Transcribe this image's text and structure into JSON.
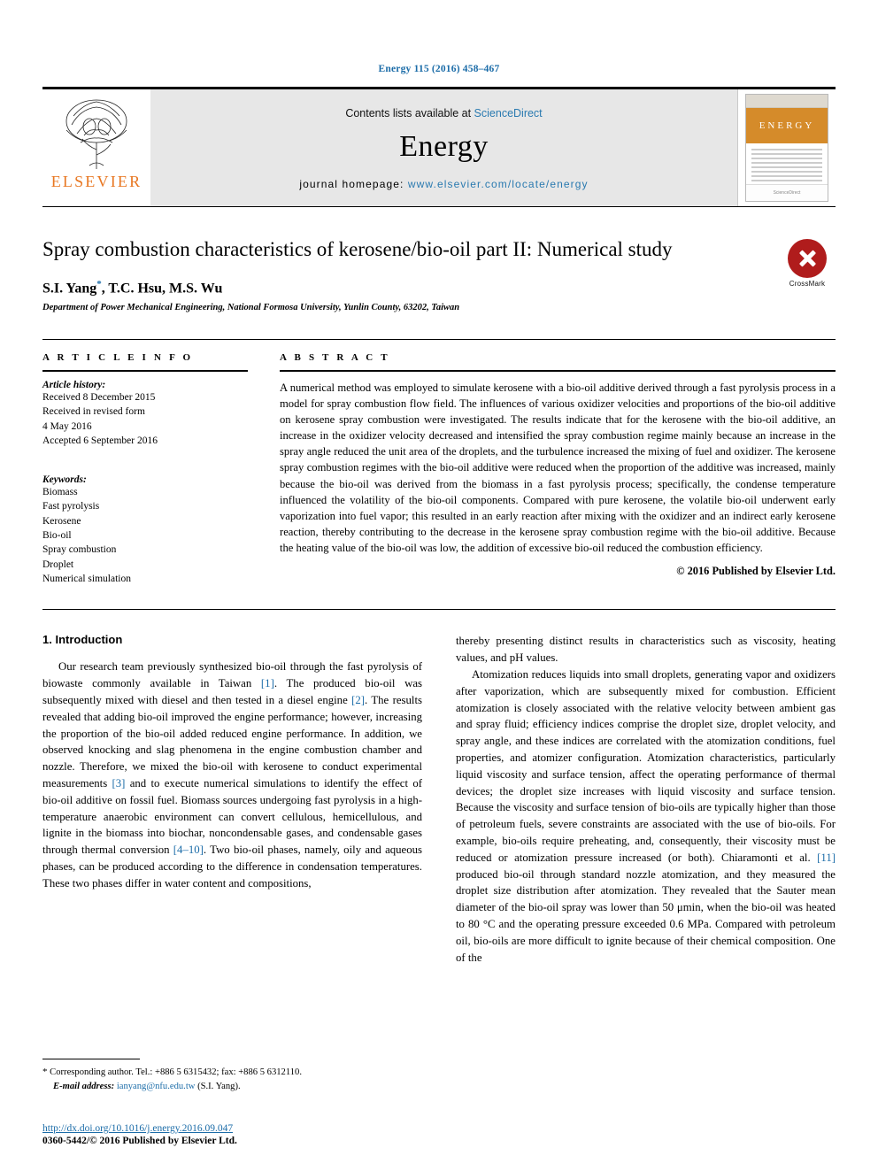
{
  "running_head": "Energy 115 (2016) 458–467",
  "masthead": {
    "publisher_name": "ELSEVIER",
    "contents_prefix": "Contents lists available at ",
    "contents_link": "ScienceDirect",
    "journal_title": "Energy",
    "homepage_prefix": "journal homepage: ",
    "homepage_url": "www.elsevier.com/locate/energy",
    "cover_band_text": "ENERGY",
    "cover_foot_text": "ScienceDirect"
  },
  "article": {
    "title": "Spray combustion characteristics of kerosene/bio-oil part II: Numerical study",
    "authors": "S.I. Yang",
    "authors_rest": ", T.C. Hsu, M.S. Wu",
    "author_marker": "*",
    "affiliation": "Department of Power Mechanical Engineering, National Formosa University, Yunlin County, 63202, Taiwan",
    "crossmark_label": "CrossMark"
  },
  "article_info": {
    "heading": "A R T I C L E   I N F O",
    "history_label": "Article history:",
    "history": [
      "Received 8 December 2015",
      "Received in revised form",
      "4 May 2016",
      "Accepted 6 September 2016"
    ],
    "keywords_label": "Keywords:",
    "keywords": [
      "Biomass",
      "Fast pyrolysis",
      "Kerosene",
      "Bio-oil",
      "Spray combustion",
      "Droplet",
      "Numerical simulation"
    ]
  },
  "abstract": {
    "heading": "A B S T R A C T",
    "text": "A numerical method was employed to simulate kerosene with a bio-oil additive derived through a fast pyrolysis process in a model for spray combustion flow field. The influences of various oxidizer velocities and proportions of the bio-oil additive on kerosene spray combustion were investigated. The results indicate that for the kerosene with the bio-oil additive, an increase in the oxidizer velocity decreased and intensified the spray combustion regime mainly because an increase in the spray angle reduced the unit area of the droplets, and the turbulence increased the mixing of fuel and oxidizer. The kerosene spray combustion regimes with the bio-oil additive were reduced when the proportion of the additive was increased, mainly because the bio-oil was derived from the biomass in a fast pyrolysis process; specifically, the condense temperature influenced the volatility of the bio-oil components. Compared with pure kerosene, the volatile bio-oil underwent early vaporization into fuel vapor; this resulted in an early reaction after mixing with the oxidizer and an indirect early kerosene reaction, thereby contributing to the decrease in the kerosene spray combustion regime with the bio-oil additive. Because the heating value of the bio-oil was low, the addition of excessive bio-oil reduced the combustion efficiency.",
    "copyright": "© 2016 Published by Elsevier Ltd."
  },
  "introduction": {
    "section_title": "1. Introduction",
    "left_para_1a": "Our research team previously synthesized bio-oil through the fast pyrolysis of biowaste commonly available in Taiwan ",
    "left_ref_1": "[1]",
    "left_para_1b": ". The produced bio-oil was subsequently mixed with diesel and then tested in a diesel engine ",
    "left_ref_2": "[2]",
    "left_para_1c": ". The results revealed that adding bio-oil improved the engine performance; however, increasing the proportion of the bio-oil added reduced engine performance. In addition, we observed knocking and slag phenomena in the engine combustion chamber and nozzle. Therefore, we mixed the bio-oil with kerosene to conduct experimental measurements ",
    "left_ref_3": "[3]",
    "left_para_1d": " and to execute numerical simulations to identify the effect of bio-oil additive on fossil fuel. Biomass sources undergoing fast pyrolysis in a high-temperature anaerobic environment can convert cellulous, hemicellulous, and lignite in the biomass into biochar, noncondensable gases, and condensable gases through thermal conversion ",
    "left_ref_4": "[4–10]",
    "left_para_1e": ". Two bio-oil phases, namely, oily and aqueous phases, can be produced according to the difference in condensation temperatures. These two phases differ in water content and compositions,",
    "right_para_1": "thereby presenting distinct results in characteristics such as viscosity, heating values, and pH values.",
    "right_para_2a": "Atomization reduces liquids into small droplets, generating vapor and oxidizers after vaporization, which are subsequently mixed for combustion. Efficient atomization is closely associated with the relative velocity between ambient gas and spray fluid; efficiency indices comprise the droplet size, droplet velocity, and spray angle, and these indices are correlated with the atomization conditions, fuel properties, and atomizer configuration. Atomization characteristics, particularly liquid viscosity and surface tension, affect the operating performance of thermal devices; the droplet size increases with liquid viscosity and surface tension. Because the viscosity and surface tension of bio-oils are typically higher than those of petroleum fuels, severe constraints are associated with the use of bio-oils. For example, bio-oils require preheating, and, consequently, their viscosity must be reduced or atomization pressure increased (or both). Chiaramonti et al. ",
    "right_ref_11": "[11]",
    "right_para_2b": " produced bio-oil through standard nozzle atomization, and they measured the droplet size distribution after atomization. They revealed that the Sauter mean diameter of the bio-oil spray was lower than 50 μmin, when the bio-oil was heated to 80 °C and the operating pressure exceeded 0.6 MPa. Compared with petroleum oil, bio-oils are more difficult to ignite because of their chemical composition. One of the"
  },
  "footnote": {
    "marker": "*",
    "corresponding": " Corresponding author. Tel.: +886 5 6315432; fax: +886 5 6312110.",
    "email_label": "E-mail address:",
    "email": "ianyang@nfu.edu.tw",
    "email_owner": " (S.I. Yang)."
  },
  "page_footer": {
    "doi": "http://dx.doi.org/10.1016/j.energy.2016.09.047",
    "issn_line": "0360-5442/© 2016 Published by Elsevier Ltd."
  },
  "colors": {
    "link": "#1b6ca8",
    "elsevier_orange": "#e87722",
    "crossmark_red": "#b01c1c"
  }
}
